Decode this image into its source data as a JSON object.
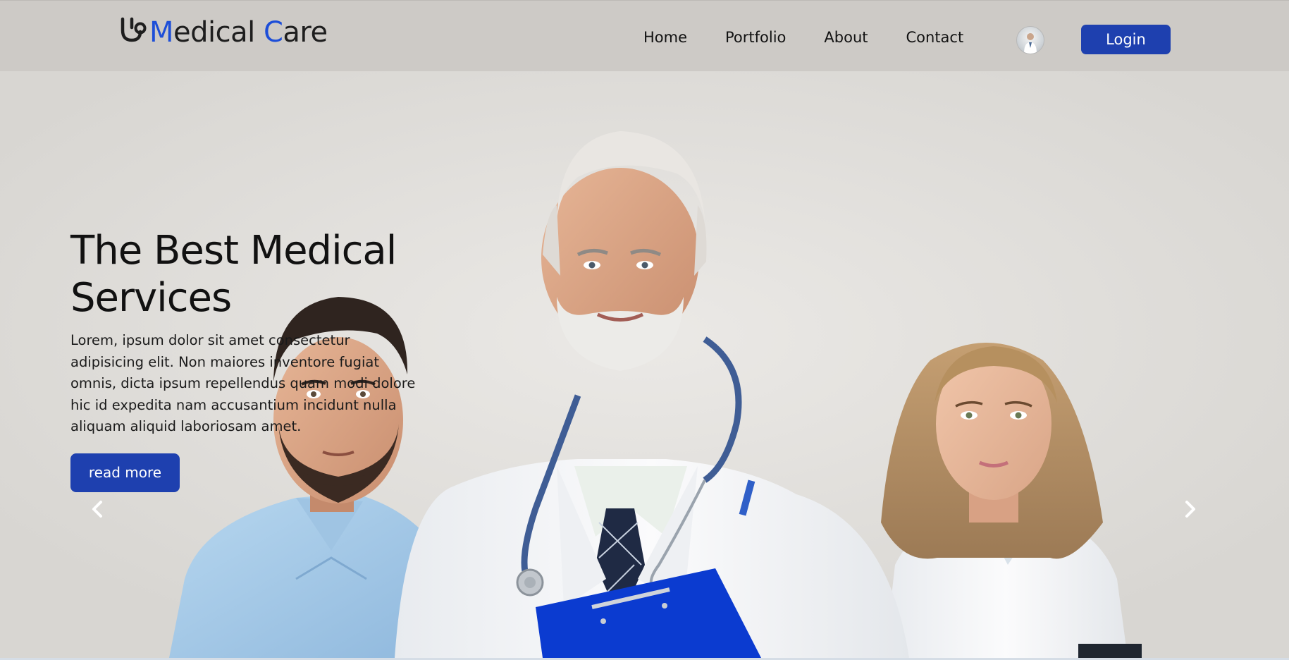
{
  "brand": {
    "icon": "stethoscope-icon",
    "part1": "M",
    "part2": "edical ",
    "part3": "C",
    "part4": "are",
    "accent_color": "#1d4ed8"
  },
  "nav": {
    "links": [
      "Home",
      "Portfolio",
      "About",
      "Contact"
    ],
    "login_label": "Login",
    "avatar_icon": "user-avatar-icon"
  },
  "hero": {
    "title_line1": "The Best Medical",
    "title_line2": "Services",
    "text": "Lorem, ipsum dolor sit amet consectetur adipisicing elit. Non maiores inventore fugiat omnis, dicta ipsum repellendus quam modi dolore hic id expedita nam accusantium incidunt nulla aliquam aliquid laboriosam amet.",
    "button_label": "read more",
    "prev_icon": "chevron-left-icon",
    "next_icon": "chevron-right-icon"
  },
  "colors": {
    "navbar_bg": "#cdcac6",
    "primary": "#1e40af",
    "clipboard": "#0b3bd0",
    "scrubs": "#a9cdea"
  }
}
